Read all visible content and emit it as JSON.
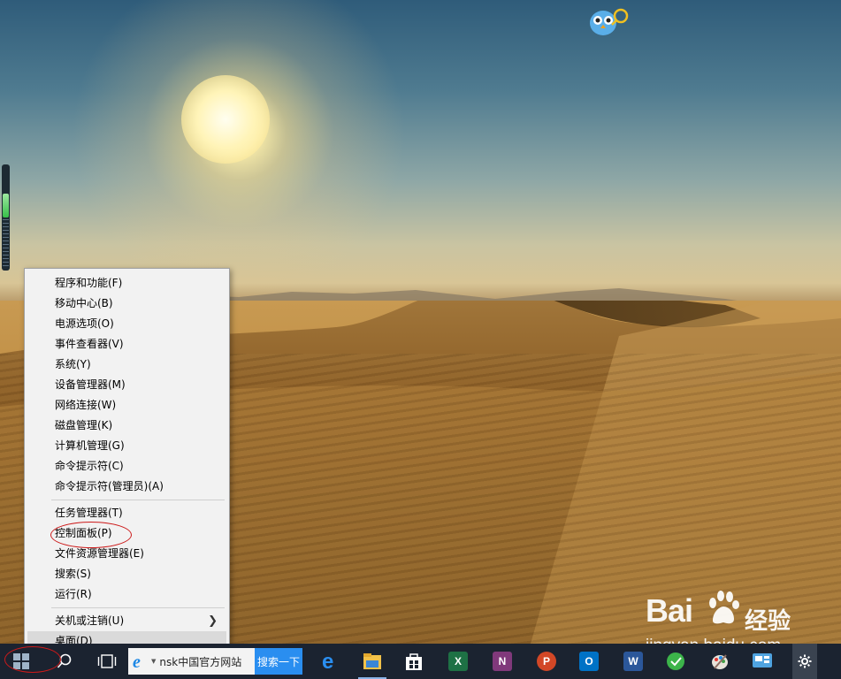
{
  "context_menu": {
    "items": [
      {
        "label": "程序和功能(F)"
      },
      {
        "label": "移动中心(B)"
      },
      {
        "label": "电源选项(O)"
      },
      {
        "label": "事件查看器(V)"
      },
      {
        "label": "系统(Y)"
      },
      {
        "label": "设备管理器(M)"
      },
      {
        "label": "网络连接(W)"
      },
      {
        "label": "磁盘管理(K)"
      },
      {
        "label": "计算机管理(G)"
      },
      {
        "label": "命令提示符(C)"
      },
      {
        "label": "命令提示符(管理员)(A)"
      },
      {
        "label": "任务管理器(T)"
      },
      {
        "label": "控制面板(P)"
      },
      {
        "label": "文件资源管理器(E)"
      },
      {
        "label": "搜索(S)"
      },
      {
        "label": "运行(R)"
      },
      {
        "label": "关机或注销(U)"
      },
      {
        "label": "桌面(D)"
      }
    ],
    "highlighted_item": "桌面(D)",
    "annotated_item": "控制面板(P)"
  },
  "taskbar": {
    "search_text": "nsk中国官方网站",
    "search_button": "搜索一下",
    "pinned_icons": [
      "start-icon",
      "cortana-search-icon",
      "task-view-icon",
      "ie-icon",
      "edge-icon",
      "file-explorer-icon",
      "store-icon",
      "excel-icon",
      "onenote-icon",
      "powerpoint-icon",
      "outlook-icon",
      "word-icon",
      "green-app-icon",
      "paint-icon",
      "chat-app-icon",
      "settings-icon"
    ]
  },
  "watermark": {
    "brand": "Bai",
    "brand_suffix": "经验",
    "url": "jingyan.baidu.com"
  },
  "colors": {
    "taskbar": "#1b2330",
    "menu_bg": "#f2f2f2",
    "highlight": "#dadada",
    "annotation_red": "#cc1a1a",
    "search_button": "#2a8ef0"
  },
  "gauge_level": 0.45
}
